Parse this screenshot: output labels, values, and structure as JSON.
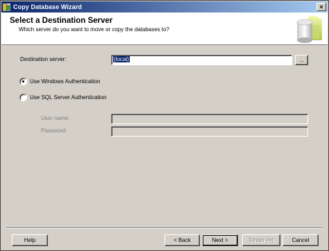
{
  "window": {
    "title": "Copy Database Wizard",
    "close_glyph": "×"
  },
  "header": {
    "title": "Select a Destination Server",
    "subtitle": "Which server do you want to move or copy the databases to?"
  },
  "destination": {
    "label": "Destination server:",
    "value": "(local)",
    "browse_label": "..."
  },
  "auth": {
    "windows_label": "Use Windows Authentication",
    "sql_label": "Use SQL Server Authentication",
    "selected": "windows"
  },
  "credentials": {
    "username_label": "User name:",
    "username_value": "",
    "password_label": "Password:",
    "password_value": ""
  },
  "buttons": {
    "help": "Help",
    "back": "< Back",
    "next": "Next >",
    "finish": "Finish >>|",
    "cancel": "Cancel"
  },
  "icons": {
    "app": "database-wizard-icon",
    "header_art": "database-cylinder-icon"
  }
}
